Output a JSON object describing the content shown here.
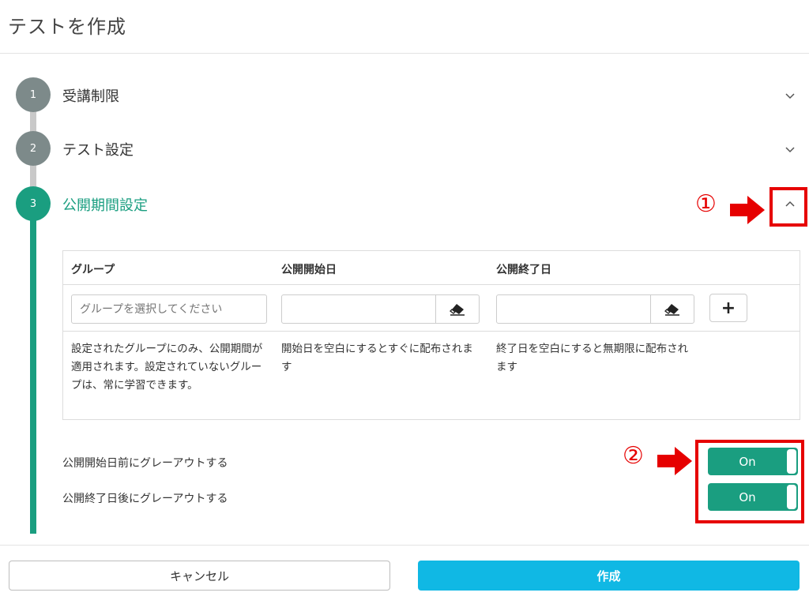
{
  "page": {
    "title": "テストを作成"
  },
  "steps": [
    {
      "number": "1",
      "label": "受講制限",
      "state": "collapsed"
    },
    {
      "number": "2",
      "label": "テスト設定",
      "state": "collapsed"
    },
    {
      "number": "3",
      "label": "公開期間設定",
      "state": "expanded"
    }
  ],
  "annotations": {
    "marker1": "①",
    "marker2": "②"
  },
  "table": {
    "headers": {
      "group": "グループ",
      "start": "公開開始日",
      "end": "公開終了日"
    },
    "group_placeholder": "グループを選択してください",
    "start_value": "",
    "end_value": "",
    "add_label": "+",
    "help": {
      "group": "設定されたグループにのみ、公開期間が適用されます。設定されていないグループは、常に学習できます。",
      "start": "開始日を空白にするとすぐに配布されます",
      "end": "終了日を空白にすると無期限に配布されます"
    }
  },
  "options": [
    {
      "label": "公開開始日前にグレーアウトする",
      "toggle": "On"
    },
    {
      "label": "公開終了日後にグレーアウトする",
      "toggle": "On"
    }
  ],
  "footer": {
    "cancel": "キャンセル",
    "create": "作成"
  },
  "icons": {
    "collapse": "chevron-up-icon",
    "expand": "chevron-down-icon",
    "clear": "eraser-icon",
    "add": "plus-icon",
    "pointer": "arrow-right-icon"
  },
  "colors": {
    "active": "#1a9e80",
    "inactive": "#7d8a8a",
    "primary": "#10b8e4",
    "annotation": "#e60000"
  }
}
